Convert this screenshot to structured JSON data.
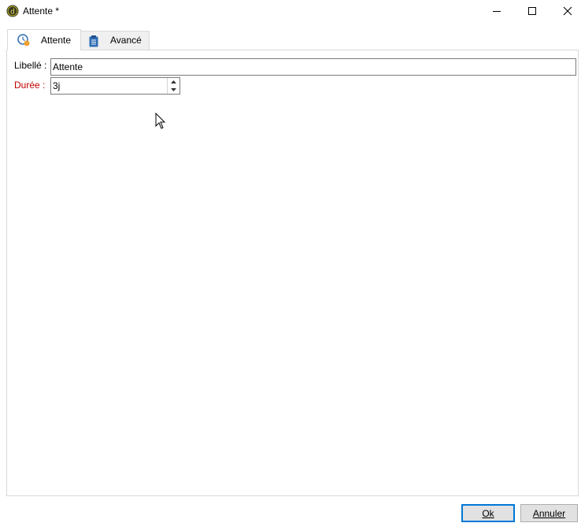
{
  "window": {
    "title": "Attente *",
    "controls": [
      "minimize-icon",
      "maximize-icon",
      "close-icon"
    ]
  },
  "tabs": [
    {
      "label": "Attente",
      "icon": "clock-icon",
      "active": true
    },
    {
      "label": "Avancé",
      "icon": "clipboard-icon",
      "active": false
    }
  ],
  "form": {
    "label_field": {
      "label": "Libellé :",
      "value": "Attente"
    },
    "duration_field": {
      "label": "Durée :",
      "value": "3j",
      "required": true,
      "label_color": "#c00000"
    }
  },
  "buttons": {
    "ok": "Ok",
    "cancel": "Annuler"
  },
  "colors": {
    "accent": "#0078d7",
    "required_label": "#c00000"
  }
}
